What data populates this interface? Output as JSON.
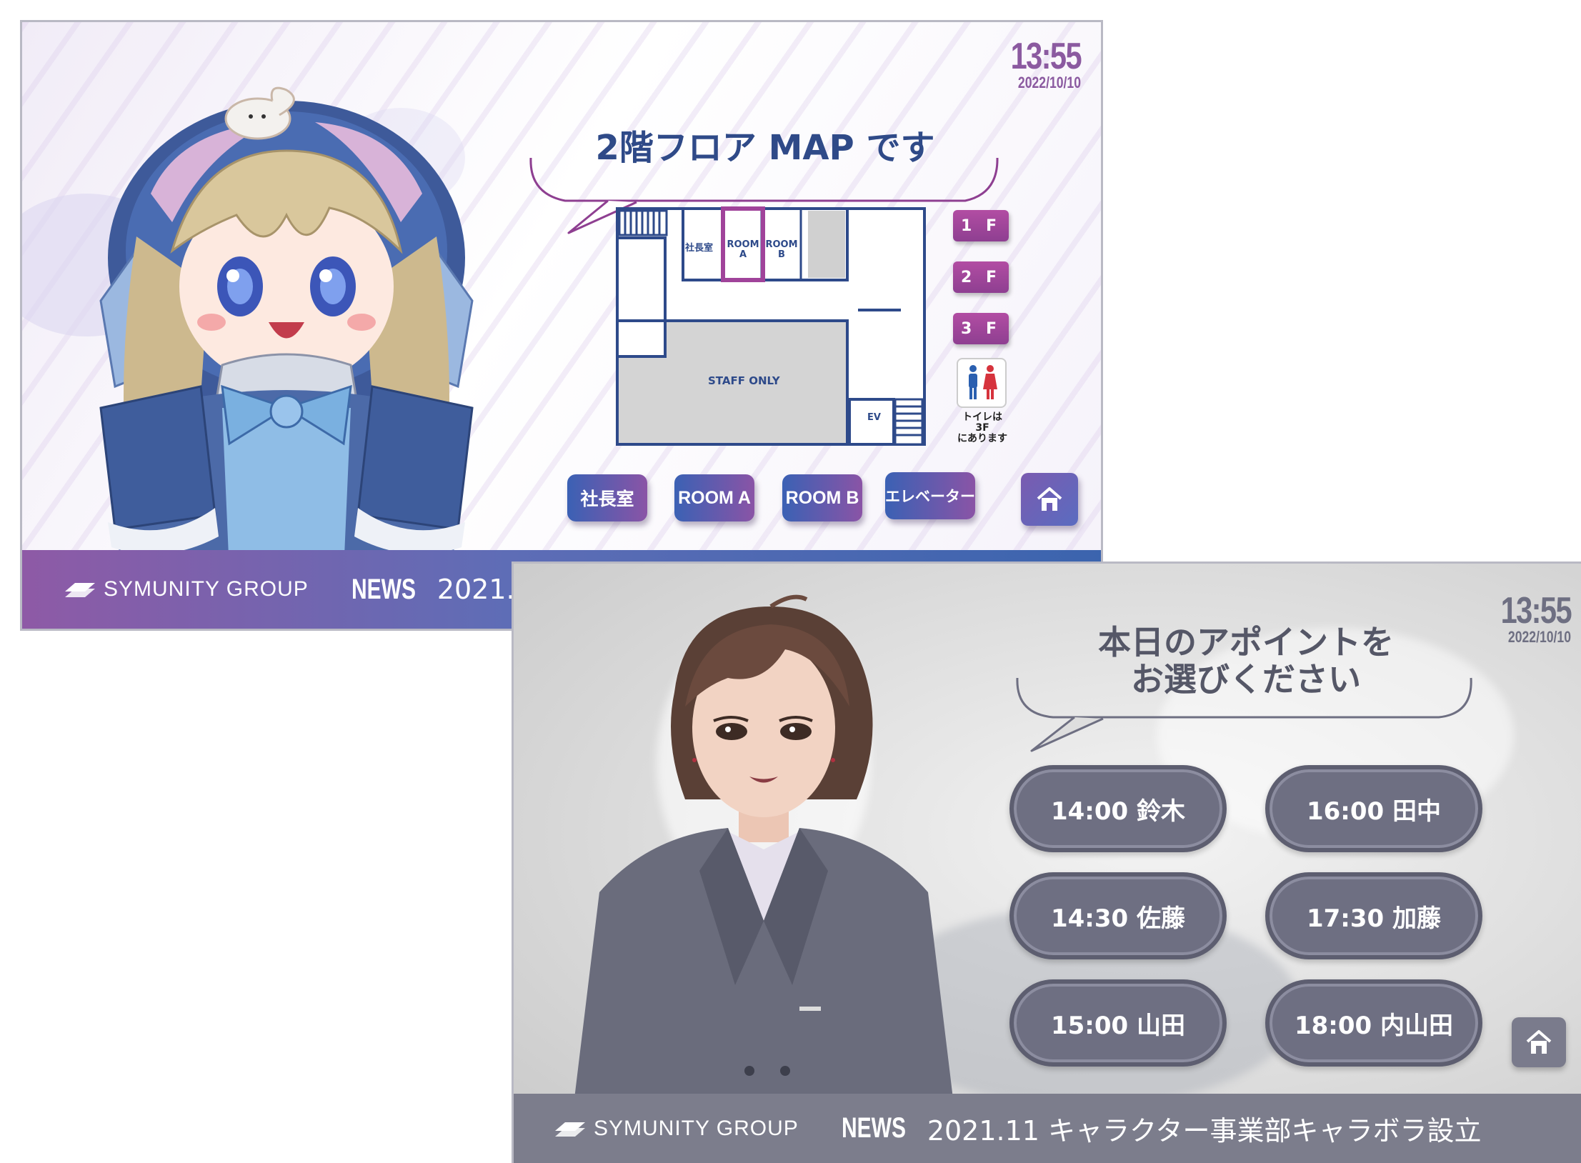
{
  "screen1": {
    "clock": {
      "time": "13:55",
      "date": "2022/10/10"
    },
    "speech": "2階フロア MAP です",
    "map": {
      "rooms": {
        "president": "社長室",
        "room_a": "ROOM A",
        "room_b": "ROOM B",
        "staff_only": "STAFF ONLY",
        "ev": "EV"
      },
      "highlight_color": "#a0439a"
    },
    "floors": [
      "1 F",
      "2 F",
      "3 F"
    ],
    "toilet_note_line1": "トイレは3F",
    "toilet_note_line2": "にあります",
    "buttons": [
      "社長室",
      "ROOM A",
      "ROOM B",
      "エレベーター"
    ],
    "home_icon": "home-icon",
    "footer": {
      "logo": "SYMUNITY GROUP",
      "news_label": "NEWS",
      "news_text": "2021."
    }
  },
  "screen2": {
    "clock": {
      "time": "13:55",
      "date": "2022/10/10"
    },
    "speech_line1": "本日のアポイントを",
    "speech_line2": "お選びください",
    "appointments": [
      "14:00 鈴木",
      "16:00 田中",
      "14:30 佐藤",
      "17:30 加藤",
      "15:00 山田",
      "18:00 内山田"
    ],
    "home_icon": "home-icon",
    "footer": {
      "logo": "SYMUNITY GROUP",
      "news_label": "NEWS",
      "news_text": "2021.11 キャラクター事業部キャラボラ設立"
    }
  },
  "colors": {
    "brand_purple": "#8e3f91",
    "brand_blue": "#3b61b4",
    "appt_gray": "#6e6f82"
  }
}
